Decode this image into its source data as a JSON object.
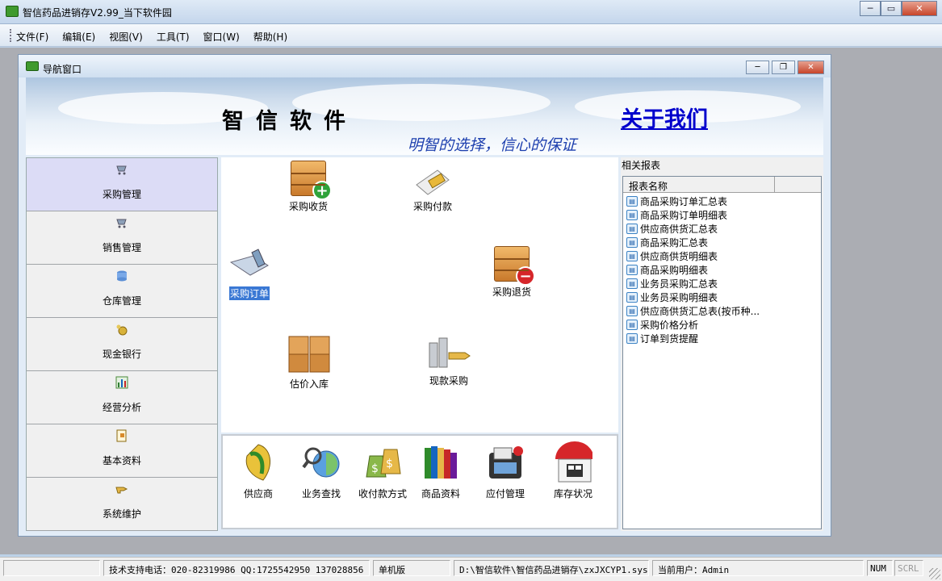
{
  "window": {
    "title": "智信药品进销存V2.99_当下软件园"
  },
  "menu": [
    "文件(F)",
    "编辑(E)",
    "视图(V)",
    "工具(T)",
    "窗口(W)",
    "帮助(H)"
  ],
  "child": {
    "title": "导航窗口"
  },
  "banner": {
    "company": "智信软件",
    "about": "关于我们",
    "slogan": "明智的选择，信心的保证"
  },
  "sidebar": [
    {
      "label": "采购管理",
      "icon": "cart-icon",
      "active": true
    },
    {
      "label": "销售管理",
      "icon": "cart-icon"
    },
    {
      "label": "仓库管理",
      "icon": "database-icon"
    },
    {
      "label": "现金银行",
      "icon": "money-bag-icon"
    },
    {
      "label": "经营分析",
      "icon": "chart-icon"
    },
    {
      "label": "基本资料",
      "icon": "document-icon"
    },
    {
      "label": "系统维护",
      "icon": "hand-pointer-icon"
    }
  ],
  "ops": {
    "receive": "采购收货",
    "pay": "采购付款",
    "order": "采购订单",
    "return": "采购退货",
    "estimate": "估价入库",
    "cash": "现款采购"
  },
  "bottom": [
    "供应商",
    "业务查找",
    "收付款方式",
    "商品资料",
    "应付管理",
    "库存状况"
  ],
  "reports": {
    "header": "相关报表",
    "column": "报表名称",
    "items": [
      "商品采购订单汇总表",
      "商品采购订单明细表",
      "供应商供货汇总表",
      "商品采购汇总表",
      "供应商供货明细表",
      "商品采购明细表",
      "业务员采购汇总表",
      "业务员采购明细表",
      "供应商供货汇总表(按币种...",
      "采购价格分析",
      "订单到货提醒"
    ]
  },
  "status": {
    "support": "技术支持电话：020-82319986 QQ:1725542950 137028856",
    "mode": "单机版",
    "path": "D:\\智信软件\\智信药品进销存\\zxJXCYP1.sys",
    "user": "当前用户：Admin",
    "num": "NUM",
    "scrl": "SCRL"
  },
  "colors": {
    "accent_link": "#0000cc",
    "slogan": "#1d3fae",
    "selection": "#3a78d4"
  }
}
